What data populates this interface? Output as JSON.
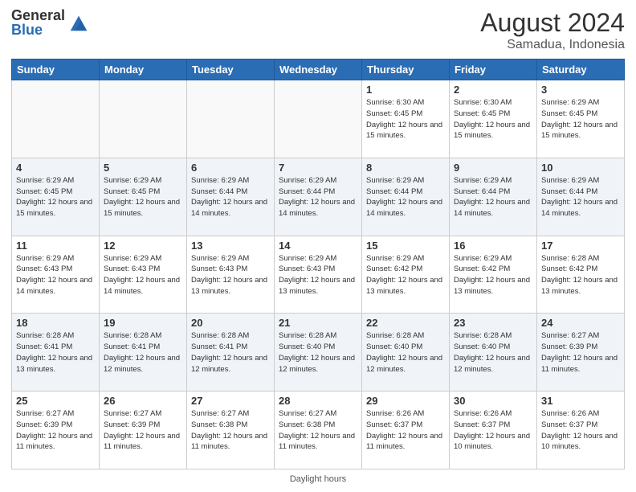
{
  "logo": {
    "general": "General",
    "blue": "Blue"
  },
  "header": {
    "month": "August 2024",
    "location": "Samadua, Indonesia"
  },
  "days_of_week": [
    "Sunday",
    "Monday",
    "Tuesday",
    "Wednesday",
    "Thursday",
    "Friday",
    "Saturday"
  ],
  "footer": {
    "label": "Daylight hours"
  },
  "weeks": [
    [
      {
        "day": "",
        "sunrise": "",
        "sunset": "",
        "daylight": ""
      },
      {
        "day": "",
        "sunrise": "",
        "sunset": "",
        "daylight": ""
      },
      {
        "day": "",
        "sunrise": "",
        "sunset": "",
        "daylight": ""
      },
      {
        "day": "",
        "sunrise": "",
        "sunset": "",
        "daylight": ""
      },
      {
        "day": "1",
        "sunrise": "Sunrise: 6:30 AM",
        "sunset": "Sunset: 6:45 PM",
        "daylight": "Daylight: 12 hours and 15 minutes."
      },
      {
        "day": "2",
        "sunrise": "Sunrise: 6:30 AM",
        "sunset": "Sunset: 6:45 PM",
        "daylight": "Daylight: 12 hours and 15 minutes."
      },
      {
        "day": "3",
        "sunrise": "Sunrise: 6:29 AM",
        "sunset": "Sunset: 6:45 PM",
        "daylight": "Daylight: 12 hours and 15 minutes."
      }
    ],
    [
      {
        "day": "4",
        "sunrise": "Sunrise: 6:29 AM",
        "sunset": "Sunset: 6:45 PM",
        "daylight": "Daylight: 12 hours and 15 minutes."
      },
      {
        "day": "5",
        "sunrise": "Sunrise: 6:29 AM",
        "sunset": "Sunset: 6:45 PM",
        "daylight": "Daylight: 12 hours and 15 minutes."
      },
      {
        "day": "6",
        "sunrise": "Sunrise: 6:29 AM",
        "sunset": "Sunset: 6:44 PM",
        "daylight": "Daylight: 12 hours and 14 minutes."
      },
      {
        "day": "7",
        "sunrise": "Sunrise: 6:29 AM",
        "sunset": "Sunset: 6:44 PM",
        "daylight": "Daylight: 12 hours and 14 minutes."
      },
      {
        "day": "8",
        "sunrise": "Sunrise: 6:29 AM",
        "sunset": "Sunset: 6:44 PM",
        "daylight": "Daylight: 12 hours and 14 minutes."
      },
      {
        "day": "9",
        "sunrise": "Sunrise: 6:29 AM",
        "sunset": "Sunset: 6:44 PM",
        "daylight": "Daylight: 12 hours and 14 minutes."
      },
      {
        "day": "10",
        "sunrise": "Sunrise: 6:29 AM",
        "sunset": "Sunset: 6:44 PM",
        "daylight": "Daylight: 12 hours and 14 minutes."
      }
    ],
    [
      {
        "day": "11",
        "sunrise": "Sunrise: 6:29 AM",
        "sunset": "Sunset: 6:43 PM",
        "daylight": "Daylight: 12 hours and 14 minutes."
      },
      {
        "day": "12",
        "sunrise": "Sunrise: 6:29 AM",
        "sunset": "Sunset: 6:43 PM",
        "daylight": "Daylight: 12 hours and 14 minutes."
      },
      {
        "day": "13",
        "sunrise": "Sunrise: 6:29 AM",
        "sunset": "Sunset: 6:43 PM",
        "daylight": "Daylight: 12 hours and 13 minutes."
      },
      {
        "day": "14",
        "sunrise": "Sunrise: 6:29 AM",
        "sunset": "Sunset: 6:43 PM",
        "daylight": "Daylight: 12 hours and 13 minutes."
      },
      {
        "day": "15",
        "sunrise": "Sunrise: 6:29 AM",
        "sunset": "Sunset: 6:42 PM",
        "daylight": "Daylight: 12 hours and 13 minutes."
      },
      {
        "day": "16",
        "sunrise": "Sunrise: 6:29 AM",
        "sunset": "Sunset: 6:42 PM",
        "daylight": "Daylight: 12 hours and 13 minutes."
      },
      {
        "day": "17",
        "sunrise": "Sunrise: 6:28 AM",
        "sunset": "Sunset: 6:42 PM",
        "daylight": "Daylight: 12 hours and 13 minutes."
      }
    ],
    [
      {
        "day": "18",
        "sunrise": "Sunrise: 6:28 AM",
        "sunset": "Sunset: 6:41 PM",
        "daylight": "Daylight: 12 hours and 13 minutes."
      },
      {
        "day": "19",
        "sunrise": "Sunrise: 6:28 AM",
        "sunset": "Sunset: 6:41 PM",
        "daylight": "Daylight: 12 hours and 12 minutes."
      },
      {
        "day": "20",
        "sunrise": "Sunrise: 6:28 AM",
        "sunset": "Sunset: 6:41 PM",
        "daylight": "Daylight: 12 hours and 12 minutes."
      },
      {
        "day": "21",
        "sunrise": "Sunrise: 6:28 AM",
        "sunset": "Sunset: 6:40 PM",
        "daylight": "Daylight: 12 hours and 12 minutes."
      },
      {
        "day": "22",
        "sunrise": "Sunrise: 6:28 AM",
        "sunset": "Sunset: 6:40 PM",
        "daylight": "Daylight: 12 hours and 12 minutes."
      },
      {
        "day": "23",
        "sunrise": "Sunrise: 6:28 AM",
        "sunset": "Sunset: 6:40 PM",
        "daylight": "Daylight: 12 hours and 12 minutes."
      },
      {
        "day": "24",
        "sunrise": "Sunrise: 6:27 AM",
        "sunset": "Sunset: 6:39 PM",
        "daylight": "Daylight: 12 hours and 11 minutes."
      }
    ],
    [
      {
        "day": "25",
        "sunrise": "Sunrise: 6:27 AM",
        "sunset": "Sunset: 6:39 PM",
        "daylight": "Daylight: 12 hours and 11 minutes."
      },
      {
        "day": "26",
        "sunrise": "Sunrise: 6:27 AM",
        "sunset": "Sunset: 6:39 PM",
        "daylight": "Daylight: 12 hours and 11 minutes."
      },
      {
        "day": "27",
        "sunrise": "Sunrise: 6:27 AM",
        "sunset": "Sunset: 6:38 PM",
        "daylight": "Daylight: 12 hours and 11 minutes."
      },
      {
        "day": "28",
        "sunrise": "Sunrise: 6:27 AM",
        "sunset": "Sunset: 6:38 PM",
        "daylight": "Daylight: 12 hours and 11 minutes."
      },
      {
        "day": "29",
        "sunrise": "Sunrise: 6:26 AM",
        "sunset": "Sunset: 6:37 PM",
        "daylight": "Daylight: 12 hours and 11 minutes."
      },
      {
        "day": "30",
        "sunrise": "Sunrise: 6:26 AM",
        "sunset": "Sunset: 6:37 PM",
        "daylight": "Daylight: 12 hours and 10 minutes."
      },
      {
        "day": "31",
        "sunrise": "Sunrise: 6:26 AM",
        "sunset": "Sunset: 6:37 PM",
        "daylight": "Daylight: 12 hours and 10 minutes."
      }
    ]
  ]
}
